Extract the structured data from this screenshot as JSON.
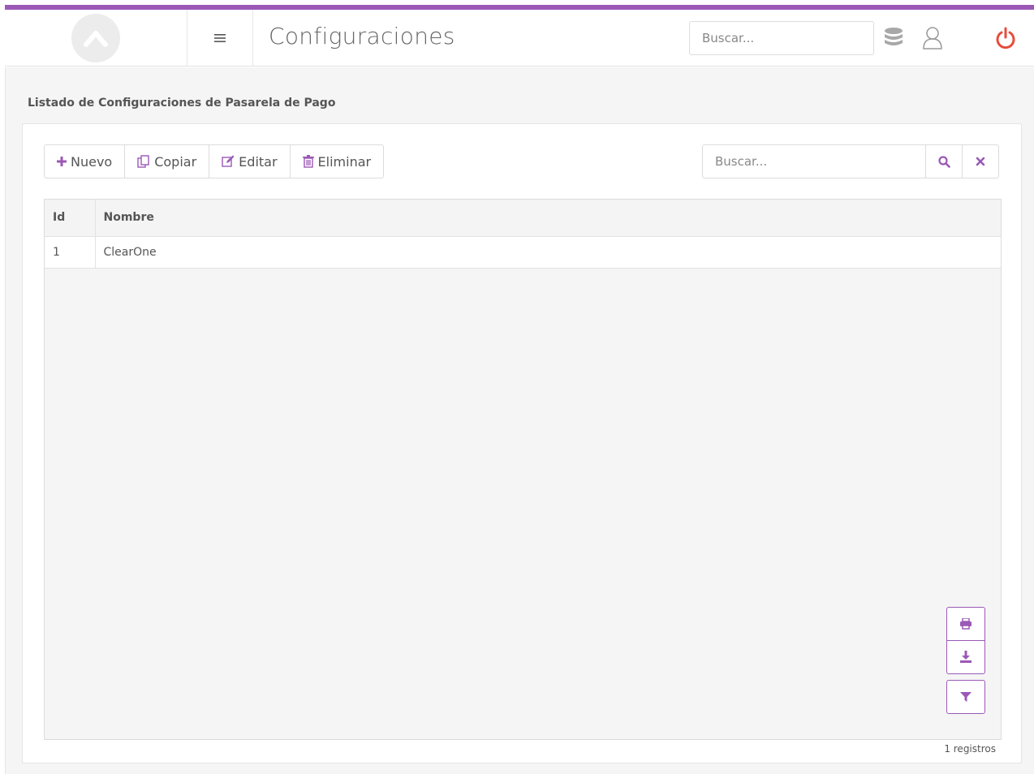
{
  "colors": {
    "accent": "#9b59b6",
    "power": "#e74c3c",
    "icon_gray": "#999999"
  },
  "header": {
    "logo_icon": "app-logo-icon",
    "menu_icon": "hamburger-icon",
    "title": "Configuraciones",
    "search_placeholder": "Buscar...",
    "icons": [
      "database-icon",
      "user-icon",
      "power-icon"
    ]
  },
  "page": {
    "section_title": "Listado de Configuraciones de Pasarela de Pago"
  },
  "toolbar": {
    "buttons": [
      {
        "label": "Nuevo",
        "icon": "plus-icon"
      },
      {
        "label": "Copiar",
        "icon": "copy-icon"
      },
      {
        "label": "Editar",
        "icon": "edit-icon"
      },
      {
        "label": "Eliminar",
        "icon": "trash-icon"
      }
    ],
    "search_placeholder": "Buscar...",
    "search_icon": "search-icon",
    "clear_icon": "clear-icon"
  },
  "table": {
    "columns": [
      "Id",
      "Nombre"
    ],
    "rows": [
      {
        "id": "1",
        "nombre": "ClearOne"
      }
    ]
  },
  "side_tools": [
    "print-icon",
    "download-icon",
    "filter-icon"
  ],
  "footer": {
    "record_count": "1 registros"
  }
}
